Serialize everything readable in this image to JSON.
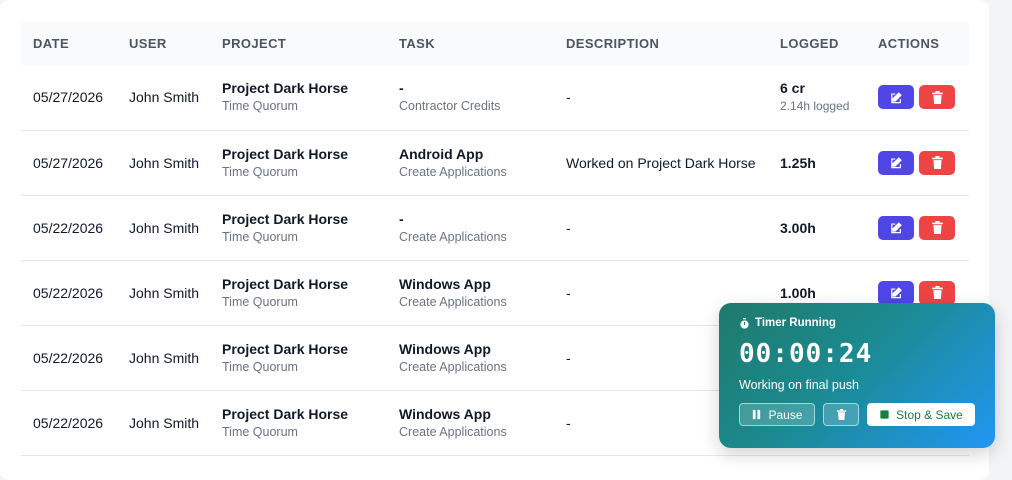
{
  "table": {
    "headers": [
      "DATE",
      "USER",
      "PROJECT",
      "TASK",
      "DESCRIPTION",
      "LOGGED",
      "ACTIONS"
    ],
    "rows": [
      {
        "date": "05/27/2026",
        "user": "John Smith",
        "project": "Project Dark Horse",
        "client": "Time Quorum",
        "task": "-",
        "task_category": "Contractor Credits",
        "description": "-",
        "logged": "6 cr",
        "logged_sub": "2.14h logged"
      },
      {
        "date": "05/27/2026",
        "user": "John Smith",
        "project": "Project Dark Horse",
        "client": "Time Quorum",
        "task": "Android App",
        "task_category": "Create Applications",
        "description": "Worked on Project Dark Horse",
        "logged": "1.25h",
        "logged_sub": ""
      },
      {
        "date": "05/22/2026",
        "user": "John Smith",
        "project": "Project Dark Horse",
        "client": "Time Quorum",
        "task": "-",
        "task_category": "Create Applications",
        "description": "-",
        "logged": "3.00h",
        "logged_sub": ""
      },
      {
        "date": "05/22/2026",
        "user": "John Smith",
        "project": "Project Dark Horse",
        "client": "Time Quorum",
        "task": "Windows App",
        "task_category": "Create Applications",
        "description": "-",
        "logged": "1.00h",
        "logged_sub": ""
      },
      {
        "date": "05/22/2026",
        "user": "John Smith",
        "project": "Project Dark Horse",
        "client": "Time Quorum",
        "task": "Windows App",
        "task_category": "Create Applications",
        "description": "-",
        "logged": "",
        "logged_sub": ""
      },
      {
        "date": "05/22/2026",
        "user": "John Smith",
        "project": "Project Dark Horse",
        "client": "Time Quorum",
        "task": "Windows App",
        "task_category": "Create Applications",
        "description": "-",
        "logged": "",
        "logged_sub": ""
      }
    ],
    "icons": {
      "edit": "edit-icon",
      "delete": "trash-icon"
    },
    "colors": {
      "edit": "#4f46e5",
      "delete": "#ef4444"
    }
  },
  "timer": {
    "status": "Timer Running",
    "elapsed": "00:00:24",
    "note": "Working on final push",
    "pause_label": "Pause",
    "stop_label": "Stop & Save",
    "icons": {
      "status": "stopwatch-icon",
      "pause": "pause-icon",
      "discard": "trash-icon",
      "stop": "stop-icon"
    },
    "colors": {
      "gradient_start": "#1f7a6a",
      "gradient_end": "#2196f3",
      "stop_text": "#15803d"
    }
  }
}
